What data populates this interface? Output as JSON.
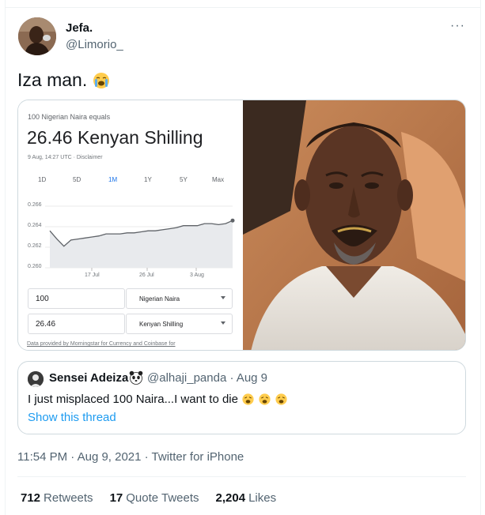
{
  "tweet": {
    "display_name": "Jefa.",
    "handle": "@Limorio_",
    "more_label": "···",
    "text": "Iza man.",
    "text_emoji": "loudly-crying-face",
    "timestamp": "11:54 PM · Aug 9, 2021 · Twitter for iPhone"
  },
  "converter": {
    "equals_label": "100 Nigerian Naira equals",
    "result": "26.46 Kenyan Shilling",
    "date_label": "9 Aug, 14:27 UTC · Disclaimer",
    "range_tabs": [
      "1D",
      "5D",
      "1M",
      "1Y",
      "5Y",
      "Max"
    ],
    "active_tab": "1M",
    "from_amount": "100",
    "from_currency": "Nigerian Naira",
    "to_amount": "26.46",
    "to_currency": "Kenyan Shilling",
    "source_note": "Data provided by Morningstar for Currency and Coinbase for"
  },
  "chart_data": {
    "type": "area",
    "y_ticks": [
      "0.266",
      "0.264",
      "0.262",
      "0.260"
    ],
    "x_ticks": [
      "17 Jul",
      "26 Jul",
      "3 Aug"
    ],
    "ylim": [
      0.26,
      0.266
    ],
    "series": [
      {
        "values": [
          0.2636,
          0.2628,
          0.2621,
          0.2627,
          0.2628,
          0.2629,
          0.263,
          0.2631,
          0.2633,
          0.2633,
          0.2633,
          0.2634,
          0.2634,
          0.2635,
          0.2636,
          0.2636,
          0.2637,
          0.2638,
          0.2639,
          0.2641,
          0.2641,
          0.2641,
          0.2643,
          0.2643,
          0.2642,
          0.2643,
          0.2646
        ]
      }
    ],
    "line_color": "#5f6368",
    "fill_color": "#e8eaed"
  },
  "quote": {
    "display_name": "Sensei Adeiza",
    "handle_time": "@alhaji_panda · Aug 9",
    "text": "I just misplaced 100 Naira...I want to die",
    "text_emoji": "weary-face",
    "show_thread": "Show this thread"
  },
  "stats": {
    "retweets_count": "712",
    "retweets_label": "Retweets",
    "quotes_count": "17",
    "quotes_label": "Quote Tweets",
    "likes_count": "2,204",
    "likes_label": "Likes"
  }
}
